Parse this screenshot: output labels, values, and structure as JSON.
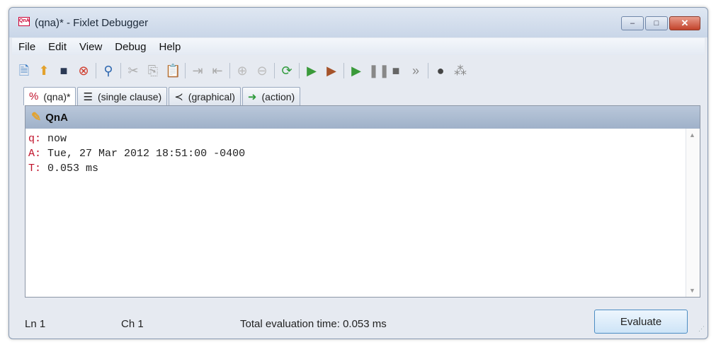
{
  "window": {
    "title": "(qna)* - Fixlet Debugger",
    "app_icon_label": "QnA",
    "controls": {
      "minimize": "–",
      "maximize": "□",
      "close": "✕"
    }
  },
  "menubar": {
    "items": [
      "File",
      "Edit",
      "View",
      "Debug",
      "Help"
    ]
  },
  "toolbar": {
    "icons": [
      "new-file-icon",
      "open-file-icon",
      "save-icon",
      "stop-icon",
      "find-icon",
      "cut-icon",
      "copy-icon",
      "paste-icon",
      "indent-icon",
      "outdent-icon",
      "zoom-in-icon",
      "zoom-out-icon",
      "refresh-icon",
      "play-icon",
      "play-alt-icon",
      "step-play-icon",
      "pause-icon",
      "stop-square-icon",
      "fast-forward-icon",
      "breakpoint-icon",
      "clear-breakpoints-icon"
    ]
  },
  "tabs": [
    {
      "label": "(qna)*",
      "icon": "qna-icon",
      "active": true
    },
    {
      "label": "(single clause)",
      "icon": "single-clause-icon",
      "active": false
    },
    {
      "label": "(graphical)",
      "icon": "graphical-icon",
      "active": false
    },
    {
      "label": "(action)",
      "icon": "action-icon",
      "active": false
    }
  ],
  "panel": {
    "header": "QnA",
    "lines": [
      {
        "key": "q:",
        "value": "now"
      },
      {
        "key": "A:",
        "value": "Tue, 27 Mar 2012 18:51:00 -0400"
      },
      {
        "key": "T:",
        "value": "0.053 ms"
      }
    ]
  },
  "status": {
    "line": "Ln 1",
    "col": "Ch 1",
    "total": "Total evaluation time: 0.053 ms",
    "evaluate_label": "Evaluate"
  },
  "colors": {
    "title_bar": "#c9d6e8",
    "panel_header": "#9fb1c9",
    "keyword_red": "#c0112a",
    "close_button": "#c2432b"
  }
}
